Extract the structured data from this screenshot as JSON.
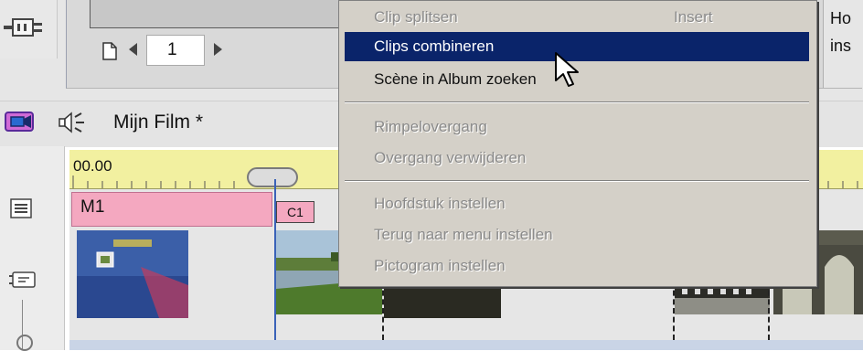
{
  "colors": {
    "menu_highlight": "#0a246a",
    "menu_background": "#d4d0c8",
    "ruler": "#f2f0a0",
    "menu_track": "#f4a8c0",
    "playhead": "#3a62b8"
  },
  "preview": {
    "page_number": "1",
    "right_info_line1": "Ho",
    "right_info_line2": "ins"
  },
  "icons": {
    "plug": "plug-icon",
    "page": "page-icon",
    "prev": "previous-arrow-icon",
    "next": "next-arrow-icon",
    "timeline_view": "camera-timeline-icon",
    "audio": "speaker-icon",
    "list": "list-icon",
    "chapter_track": "chapter-track-icon"
  },
  "timeline": {
    "movie_title": "Mijn Film *",
    "time_label": "00.00",
    "menu_track_label": "M1",
    "chapter_marker": "C1"
  },
  "context_menu": {
    "items": [
      {
        "label": "Clip splitsen",
        "shortcut": "Insert",
        "enabled": false
      },
      {
        "label": "Clips combineren",
        "enabled": true,
        "highlighted": true
      },
      {
        "label": "Scène in Album zoeken",
        "enabled": true
      },
      {
        "label": "Rimpelovergang",
        "enabled": false
      },
      {
        "label": "Overgang verwijderen",
        "enabled": false
      },
      {
        "label": "Hoofdstuk instellen",
        "enabled": false
      },
      {
        "label": "Terug naar menu instellen",
        "enabled": false
      },
      {
        "label": "Pictogram instellen",
        "enabled": false
      }
    ]
  }
}
